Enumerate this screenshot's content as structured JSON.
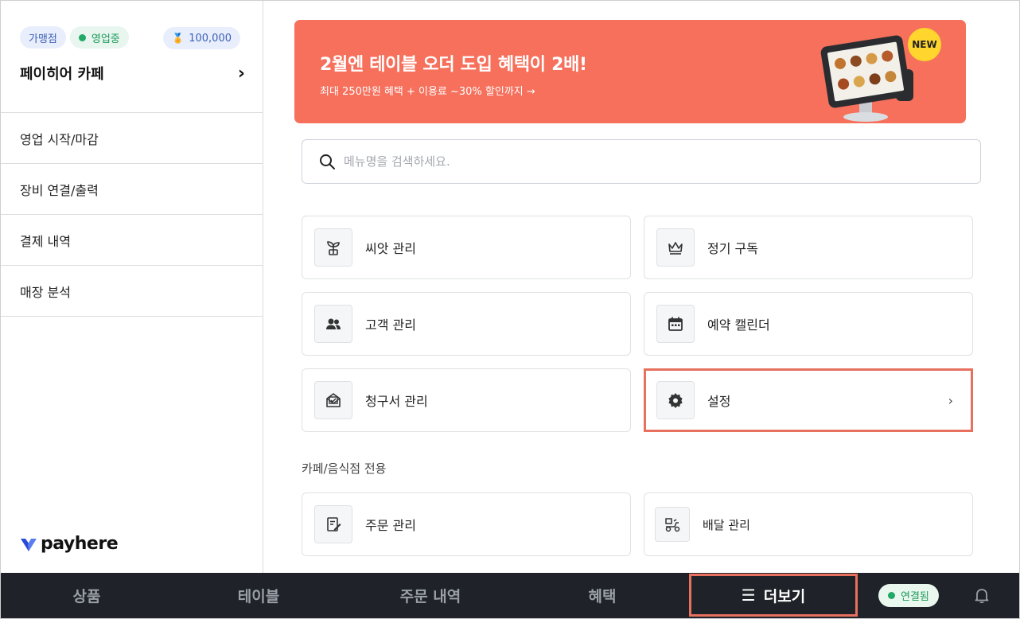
{
  "sidebar": {
    "badges": {
      "type": "가맹점",
      "status": "영업중",
      "points": "100,000"
    },
    "store_name": "페이히어 카페",
    "menu": [
      "영업 시작/마감",
      "장비 연결/출력",
      "결제 내역",
      "매장 분석"
    ],
    "logo_text": "payhere"
  },
  "banner": {
    "title": "2월엔 테이블 오더 도입 혜택이 2배!",
    "subtitle": "최대 250만원 혜택 + 이용료 ~30% 할인까지 →",
    "badge": "NEW"
  },
  "search": {
    "placeholder": "메뉴명을 검색하세요."
  },
  "cards": {
    "seed": "씨앗 관리",
    "subscription": "정기 구독",
    "customer": "고객 관리",
    "reservation": "예약 캘린더",
    "invoice": "청구서 관리",
    "settings": "설정"
  },
  "section": {
    "label": "카페/음식점 전용",
    "order": "주문 관리",
    "delivery": "배달 관리"
  },
  "bottom": {
    "tabs": [
      "상품",
      "테이블",
      "주문 내역",
      "혜택"
    ],
    "more": "더보기",
    "connection": "연결됨"
  },
  "colors": {
    "banner": "#f6705c",
    "highlight": "#e8705f",
    "bottom_bar": "#1f2228",
    "status_green": "#22a867"
  }
}
